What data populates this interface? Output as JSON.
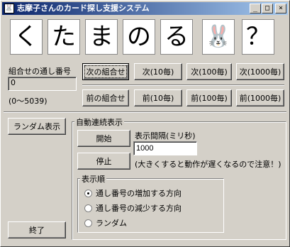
{
  "window": {
    "title": "志摩子さんのカード探し支援システム",
    "icon_glyph": "🐰",
    "min_glyph": "_",
    "max_glyph": "□",
    "close_glyph": "×"
  },
  "cards": [
    "く",
    "た",
    "ま",
    "の",
    "る",
    "🐰",
    "？"
  ],
  "serial": {
    "label": "組合せの通し番号",
    "value": "0",
    "range": "(0〜5039)"
  },
  "nav": {
    "next": [
      "次の組合せ",
      "次(10毎)",
      "次(100毎)",
      "次(1000毎)"
    ],
    "prev": [
      "前の組合せ",
      "前(10毎)",
      "前(100毎)",
      "前(1000毎)"
    ]
  },
  "random_button": "ランダム表示",
  "auto": {
    "title": "自動連続表示",
    "start": "開始",
    "stop": "停止",
    "interval_label": "表示間隔(ミリ秒)",
    "interval_value": "1000",
    "note": "(大きくすると動作が遅くなるので注意！)",
    "order": {
      "title": "表示順",
      "options": [
        "通し番号の増加する方向",
        "通し番号の減少する方向",
        "ランダム"
      ],
      "selected_index": 0
    }
  },
  "exit_button": "終了"
}
